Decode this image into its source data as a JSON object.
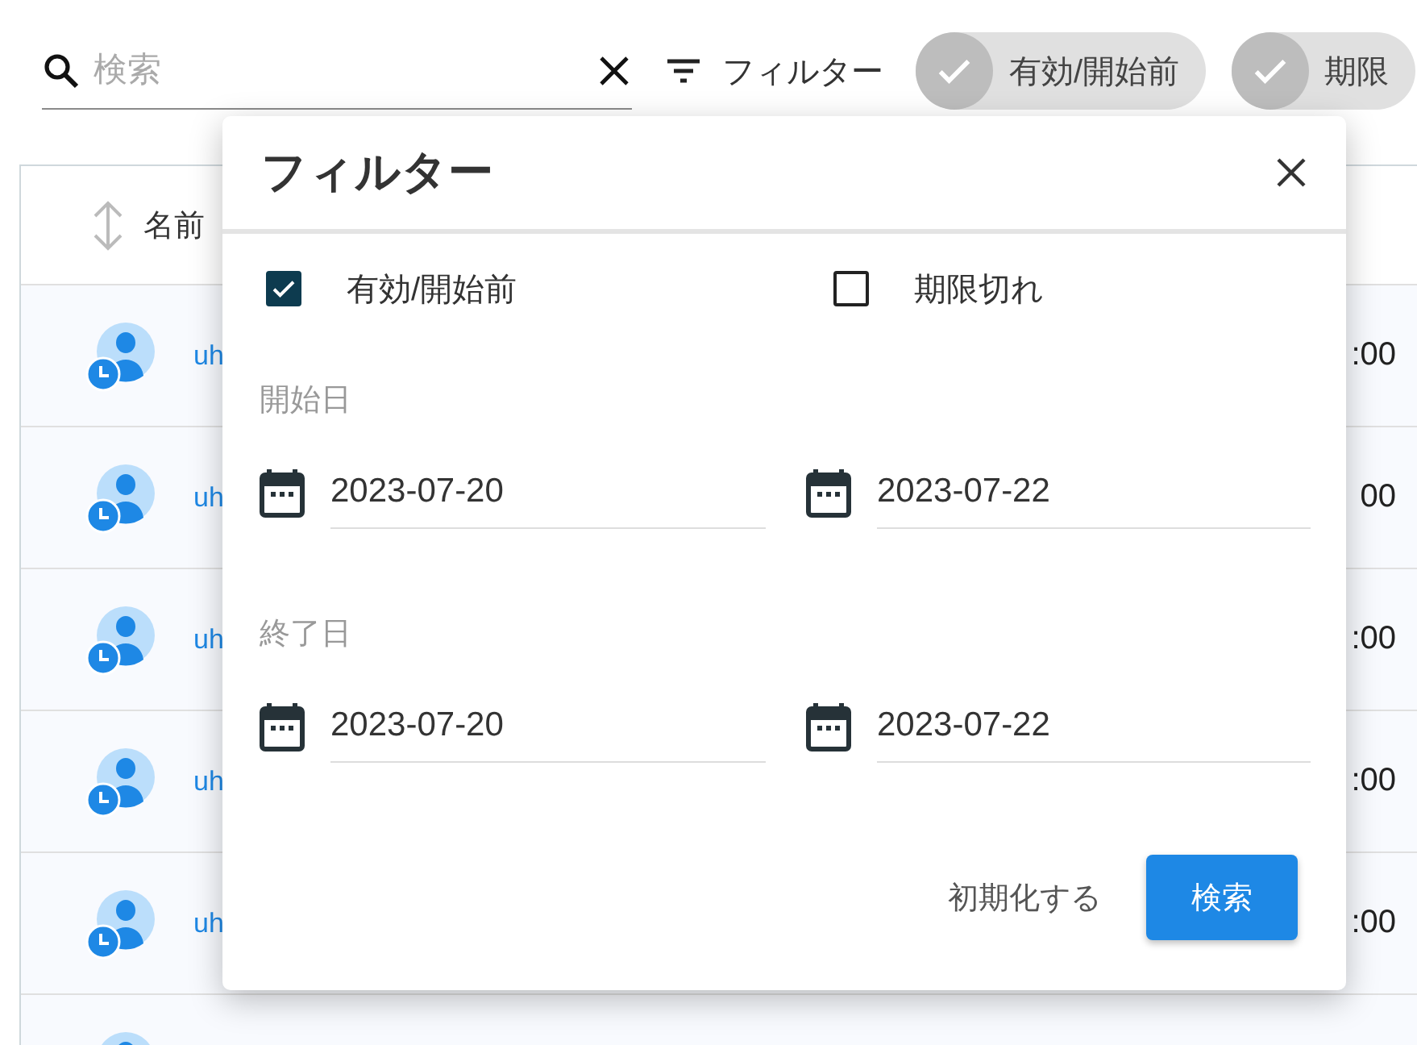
{
  "toolbar": {
    "search": {
      "placeholder": "検索"
    },
    "filter_button": "フィルター",
    "chips": [
      {
        "label": "有効/開始前",
        "selected": true
      },
      {
        "label": "期限",
        "selected": true
      }
    ]
  },
  "table": {
    "columns": [
      {
        "label": "名前"
      }
    ],
    "rows": [
      {
        "kind": "user",
        "name": "uh",
        "time": ":00"
      },
      {
        "kind": "user",
        "name": "uh",
        "time": "00"
      },
      {
        "kind": "user",
        "name": "uh",
        "time": ":00"
      },
      {
        "kind": "user",
        "name": "uh",
        "time": ":00"
      },
      {
        "kind": "user",
        "name": "uh",
        "time": ":00"
      },
      {
        "kind": "partial"
      }
    ]
  },
  "dialog": {
    "title": "フィルター",
    "statuses": [
      {
        "label": "有効/開始前",
        "checked": true
      },
      {
        "label": "期限切れ",
        "checked": false
      }
    ],
    "ranges": [
      {
        "label": "開始日",
        "from": "2023-07-20",
        "to": "2023-07-22"
      },
      {
        "label": "終了日",
        "from": "2023-07-20",
        "to": "2023-07-22"
      }
    ],
    "buttons": [
      {
        "label": "初期化する",
        "kind": "text"
      },
      {
        "label": "検索",
        "kind": "primary"
      }
    ]
  }
}
